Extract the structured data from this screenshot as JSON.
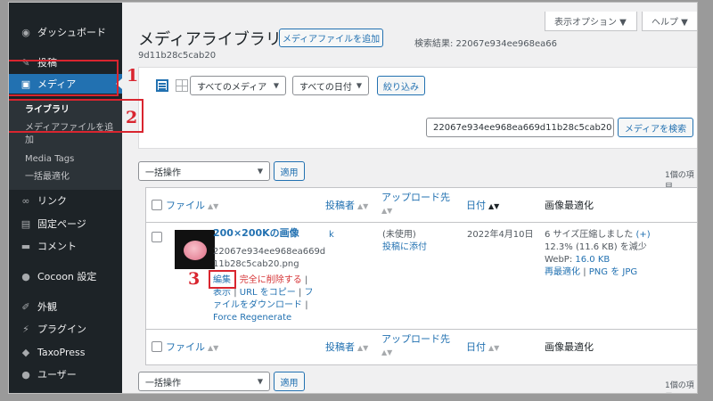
{
  "sidebar": {
    "items": [
      {
        "label": "ダッシュボード",
        "icon": "dashboard-icon"
      },
      {
        "label": "投稿",
        "icon": "pin-icon"
      },
      {
        "label": "メディア",
        "icon": "media-icon"
      },
      {
        "label": "リンク",
        "icon": "link-icon"
      },
      {
        "label": "固定ページ",
        "icon": "page-icon"
      },
      {
        "label": "コメント",
        "icon": "comment-icon"
      },
      {
        "label": "Cocoon 設定",
        "icon": "cocoon-icon"
      },
      {
        "label": "外観",
        "icon": "brush-icon"
      },
      {
        "label": "プラグイン",
        "icon": "plugin-icon"
      },
      {
        "label": "TaxoPress",
        "icon": "taxopress-icon"
      },
      {
        "label": "ユーザー",
        "icon": "user-icon"
      }
    ],
    "submenu": [
      "ライブラリ",
      "メディアファイルを追",
      "加",
      "Media Tags",
      "一括最適化"
    ]
  },
  "annotations": {
    "n1": "1",
    "n2": "2",
    "n3": "3"
  },
  "top_buttons": {
    "screen_options": "表示オプション ▼",
    "help": "ヘルプ ▼"
  },
  "header": {
    "title": "メディアライブラリ",
    "add_button": "メディアファイルを追加",
    "search_result_line1": "検索結果: 22067e934ee968ea66",
    "search_result_line2": "9d11b28c5cab20"
  },
  "filters": {
    "media_type": "すべてのメディア",
    "date": "すべての日付",
    "filter_button": "絞り込み",
    "search_value": "22067e934ee968ea669d11b28c5cab20",
    "search_button": "メディアを検索"
  },
  "bulk": {
    "select": "一括操作",
    "apply": "適用",
    "count": "1個の項目"
  },
  "table": {
    "columns": [
      "ファイル",
      "投稿者",
      "アップロード先",
      "日付",
      "画像最適化"
    ],
    "row": {
      "title": "200×200Kの画像",
      "filename_1": "22067e934ee968ea669d",
      "filename_2": "11b28c5cab20.png",
      "action_edit": "編集",
      "action_delete": "完全に削除する",
      "action_view": "表示",
      "action_copy": "URL をコピー",
      "action_download_1": "フ",
      "action_download_2": "ァイルをダウンロード",
      "action_regenerate": "Force Regenerate",
      "author": "k",
      "upload_to_1": "(未使用)",
      "upload_to_2": "投稿に添付",
      "date": "2022年4月10日",
      "opt_line1": "6 サイズ圧縮しました",
      "opt_plus": "(+)",
      "opt_line2": "12.3% (11.6 KB) を減少",
      "opt_line3_label": "WebP:",
      "opt_line3_value": "16.0 KB",
      "opt_reopt": "再最適化",
      "opt_png_jpg": "PNG を JPG"
    }
  }
}
